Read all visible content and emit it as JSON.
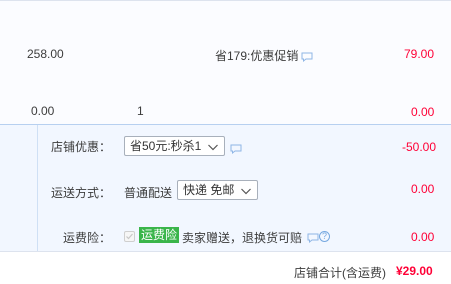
{
  "item_row": {
    "unit_price": "258.00",
    "promo_text": "省179:优惠促销",
    "subtotal": "79.00"
  },
  "extra_row": {
    "price": "0.00",
    "quantity": "1",
    "subtotal": "0.00"
  },
  "store_discount": {
    "label": "店铺优惠：",
    "selected_option": "省50元:秒杀1",
    "amount": "-50.00"
  },
  "shipping": {
    "label": "运送方式：",
    "method": "普通配送",
    "selected_option": "快递 免邮",
    "amount": "0.00"
  },
  "shipping_insurance": {
    "label": "运费险：",
    "badge": "运费险",
    "description": "卖家赠送，退换货可赔",
    "amount": "0.00"
  },
  "store_total": {
    "label": "店铺合计(含运费)",
    "amount": "¥29.00"
  },
  "colors": {
    "price_red": "#ff0036",
    "badge_green": "#3ab54a",
    "panel_bg": "#f2f7ff"
  }
}
